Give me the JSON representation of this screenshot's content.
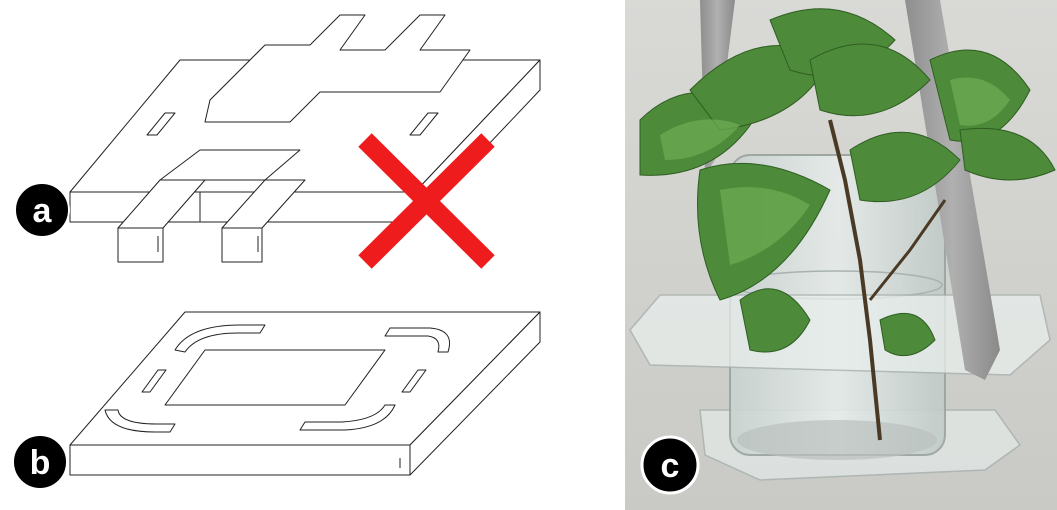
{
  "figure": {
    "panels": [
      {
        "label": "a",
        "content": "layered-lasercut-structure",
        "status": "rejected"
      },
      {
        "label": "b",
        "content": "single-sheet-plate-with-cutouts"
      },
      {
        "label": "c",
        "content": "photo-plant-in-glass-jar-on-acrylic-holder"
      }
    ],
    "reject_mark": {
      "icon": "x-mark-icon",
      "color": "#ee1c1c"
    },
    "badge_color": "#000000",
    "badge_text_color": "#ffffff",
    "line_color": "#222222"
  }
}
